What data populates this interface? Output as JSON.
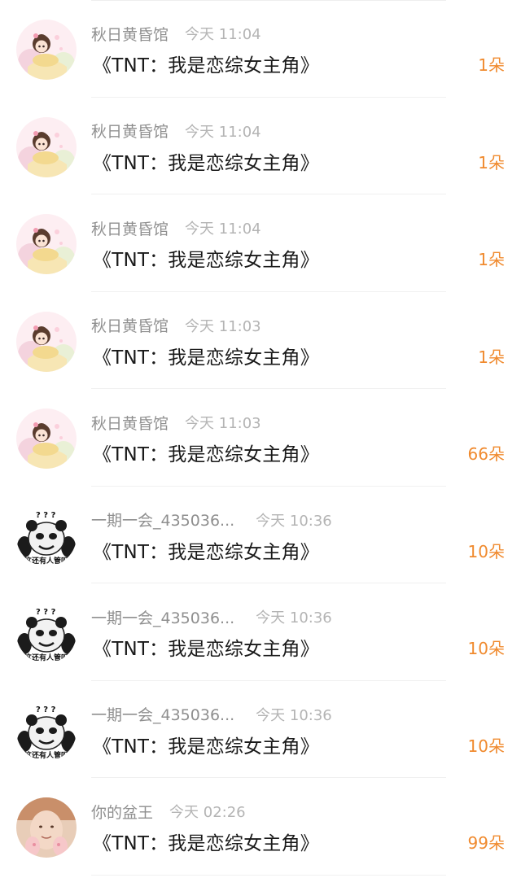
{
  "gifts": [
    {
      "user": "秋日黄昏馆",
      "time": "今天 11:04",
      "title": "《TNT：我是恋综女主角》",
      "count": "1朵",
      "avatar": "anime-girl-avatar"
    },
    {
      "user": "秋日黄昏馆",
      "time": "今天 11:04",
      "title": "《TNT：我是恋综女主角》",
      "count": "1朵",
      "avatar": "anime-girl-avatar"
    },
    {
      "user": "秋日黄昏馆",
      "time": "今天 11:04",
      "title": "《TNT：我是恋综女主角》",
      "count": "1朵",
      "avatar": "anime-girl-avatar"
    },
    {
      "user": "秋日黄昏馆",
      "time": "今天 11:03",
      "title": "《TNT：我是恋综女主角》",
      "count": "1朵",
      "avatar": "anime-girl-avatar"
    },
    {
      "user": "秋日黄昏馆",
      "time": "今天 11:03",
      "title": "《TNT：我是恋综女主角》",
      "count": "66朵",
      "avatar": "anime-girl-avatar"
    },
    {
      "user": "一期一会_435036...",
      "time": "今天 10:36",
      "title": "《TNT：我是恋综女主角》",
      "count": "10朵",
      "avatar": "panda-meme-avatar",
      "avatar_caption": "这还有人管吗"
    },
    {
      "user": "一期一会_435036...",
      "time": "今天 10:36",
      "title": "《TNT：我是恋综女主角》",
      "count": "10朵",
      "avatar": "panda-meme-avatar",
      "avatar_caption": "这还有人管吗"
    },
    {
      "user": "一期一会_435036...",
      "time": "今天 10:36",
      "title": "《TNT：我是恋综女主角》",
      "count": "10朵",
      "avatar": "panda-meme-avatar",
      "avatar_caption": "这还有人管吗"
    },
    {
      "user": "你的盆王",
      "time": "今天 02:26",
      "title": "《TNT：我是恋综女主角》",
      "count": "99朵",
      "avatar": "photo-avatar"
    }
  ],
  "colors": {
    "count": "#f08a2e",
    "username": "#8f8f8f",
    "time": "#b4b4b4",
    "title": "#1a1a1a",
    "divider": "#f0f0f0"
  }
}
